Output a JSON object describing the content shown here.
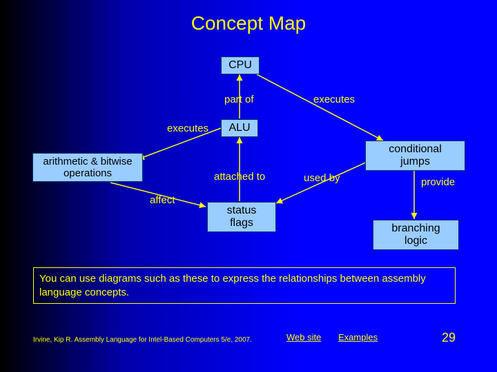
{
  "title": "Concept Map",
  "nodes": {
    "cpu": "CPU",
    "alu": "ALU",
    "arith": "arithmetic & bitwise operations",
    "cond": "conditional jumps",
    "status": "status flags",
    "branch": "branching logic"
  },
  "edges": {
    "part_of": "part of",
    "executes_top": "executes",
    "executes_left": "executes",
    "attached_to": "attached to",
    "used_by": "used by",
    "provide": "provide",
    "affect": "affect"
  },
  "note": "You can use diagrams such as these to express the relationships between assembly language concepts.",
  "footer": {
    "citation": "Irvine, Kip R. Assembly Language for Intel-Based Computers 5/e, 2007.",
    "web": "Web site",
    "examples": "Examples",
    "slide": "29"
  }
}
